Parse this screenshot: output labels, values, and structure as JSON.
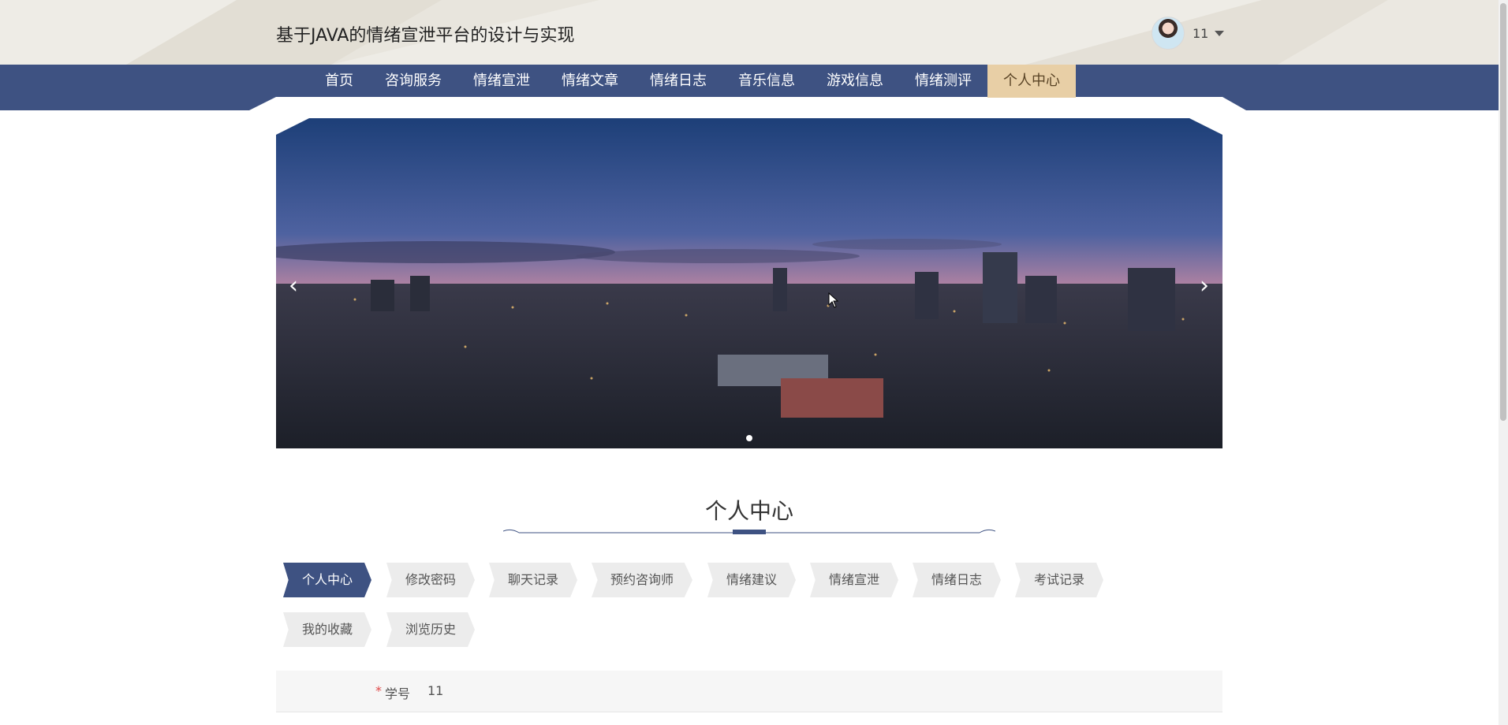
{
  "header": {
    "site_title": "基于JAVA的情绪宣泄平台的设计与实现",
    "username": "11",
    "avatar_icon": "user-avatar",
    "caret_icon": "caret-down-icon"
  },
  "nav": {
    "items": [
      {
        "label": "首页"
      },
      {
        "label": "咨询服务"
      },
      {
        "label": "情绪宣泄"
      },
      {
        "label": "情绪文章"
      },
      {
        "label": "情绪日志"
      },
      {
        "label": "音乐信息"
      },
      {
        "label": "游戏信息"
      },
      {
        "label": "情绪测评"
      },
      {
        "label": "个人中心"
      }
    ],
    "active_index": 8,
    "bar_color": "#3e5282",
    "active_color": "#e8cfa6"
  },
  "banner": {
    "prev_icon": "chevron-left-icon",
    "next_icon": "chevron-right-icon",
    "slide_count": 1,
    "active_slide": 1
  },
  "section": {
    "title": "个人中心"
  },
  "tabs": {
    "items": [
      {
        "label": "个人中心"
      },
      {
        "label": "修改密码"
      },
      {
        "label": "聊天记录"
      },
      {
        "label": "预约咨询师"
      },
      {
        "label": "情绪建议"
      },
      {
        "label": "情绪宣泄"
      },
      {
        "label": "情绪日志"
      },
      {
        "label": "考试记录"
      },
      {
        "label": "我的收藏"
      },
      {
        "label": "浏览历史"
      }
    ],
    "active_index": 0
  },
  "form": {
    "fields": [
      {
        "required_mark": "*",
        "label": "学号",
        "value": "11"
      }
    ]
  }
}
